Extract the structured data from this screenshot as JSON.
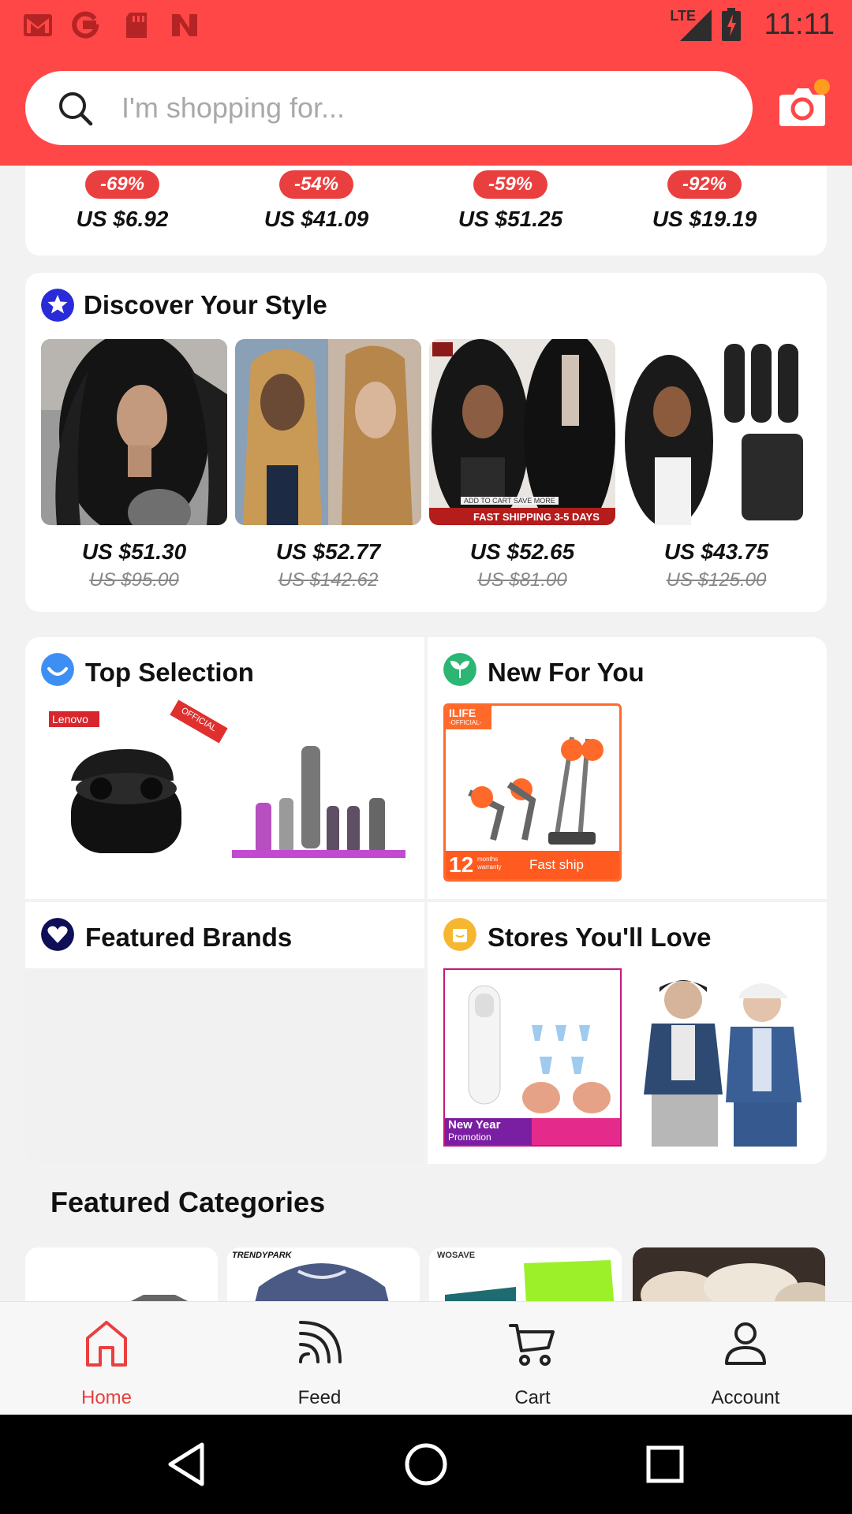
{
  "status_bar": {
    "time": "11:11",
    "network": "LTE",
    "icons": [
      "gmail-icon",
      "google-icon",
      "sd-card-icon",
      "n-app-icon"
    ]
  },
  "search": {
    "placeholder": "I'm shopping for..."
  },
  "deals": [
    {
      "discount": "-69%",
      "price": "US $6.92"
    },
    {
      "discount": "-54%",
      "price": "US $41.09"
    },
    {
      "discount": "-59%",
      "price": "US $51.25"
    },
    {
      "discount": "-92%",
      "price": "US $19.19"
    }
  ],
  "discover": {
    "title": "Discover Your Style",
    "items": [
      {
        "price": "US $51.30",
        "was": "US $95.00"
      },
      {
        "price": "US $52.77",
        "was": "US $142.62"
      },
      {
        "price": "US $52.65",
        "was": "US $81.00"
      },
      {
        "price": "US $43.75",
        "was": "US $125.00"
      }
    ],
    "banner_text": "FAST SHIPPING 3-5 DAYS",
    "banner_small": "ADD TO CART SAVE MORE"
  },
  "sections": {
    "top_selection": "Top Selection",
    "new_for_you": "New For You",
    "featured_brands": "Featured Brands",
    "stores": "Stores You'll Love"
  },
  "product_labels": {
    "lenovo": "Lenovo",
    "official": "OFFICIAL",
    "ilife": "ILIFE",
    "ilife_sub": "-OFFICIAL-",
    "warranty_num": "12",
    "warranty_text": "months warranty",
    "fast_ship": "Fast ship",
    "new_year": "New Year",
    "promotion": "Promotion"
  },
  "featured_categories": {
    "title": "Featured Categories",
    "labels": [
      "TRENDYPARK",
      "WOSAVE"
    ]
  },
  "bottom_nav": [
    {
      "label": "Home",
      "icon": "home-icon",
      "active": true
    },
    {
      "label": "Feed",
      "icon": "feed-icon",
      "active": false
    },
    {
      "label": "Cart",
      "icon": "cart-icon",
      "active": false
    },
    {
      "label": "Account",
      "icon": "account-icon",
      "active": false
    }
  ],
  "colors": {
    "brand": "#ff4747",
    "badge": "#ea3f3f",
    "active_nav": "#ea3f3f"
  }
}
